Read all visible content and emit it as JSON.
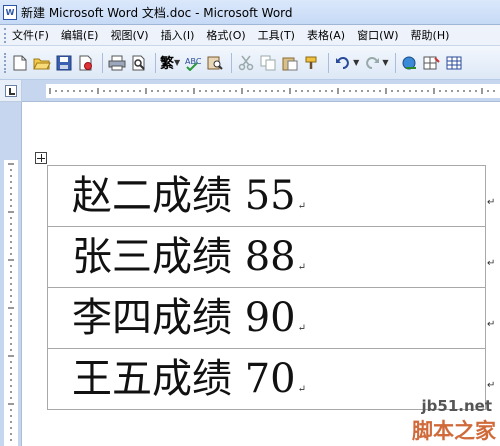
{
  "window": {
    "title": "新建 Microsoft Word 文档.doc - Microsoft Word",
    "app_icon": "word-doc-icon"
  },
  "menu": {
    "items": [
      {
        "label": "文件(F)"
      },
      {
        "label": "编辑(E)"
      },
      {
        "label": "视图(V)"
      },
      {
        "label": "插入(I)"
      },
      {
        "label": "格式(O)"
      },
      {
        "label": "工具(T)"
      },
      {
        "label": "表格(A)"
      },
      {
        "label": "窗口(W)"
      },
      {
        "label": "帮助(H)"
      }
    ]
  },
  "toolbar": {
    "traditional_label": "繁",
    "icons": [
      "new-document-icon",
      "open-folder-icon",
      "save-icon",
      "permission-icon",
      "print-icon",
      "print-preview-icon",
      "spelling-icon",
      "research-icon",
      "cut-icon",
      "copy-icon",
      "paste-icon",
      "format-painter-icon",
      "undo-icon",
      "redo-icon",
      "hyperlink-icon",
      "tables-borders-icon",
      "insert-table-icon"
    ]
  },
  "document": {
    "rows": [
      {
        "text": "赵二成绩 55"
      },
      {
        "text": "张三成绩 88"
      },
      {
        "text": "李四成绩 90"
      },
      {
        "text": "王五成绩 70"
      }
    ],
    "cell_end_mark": "↵",
    "row_end_mark": "↵"
  },
  "watermark": {
    "site": "jb51.net",
    "name": "脚本之家"
  },
  "colors": {
    "titlebar": "#c6daf6",
    "toolbar": "#dde8f6",
    "ruler": "#c5d6ee",
    "watermark_accent": "#d06a3a"
  }
}
